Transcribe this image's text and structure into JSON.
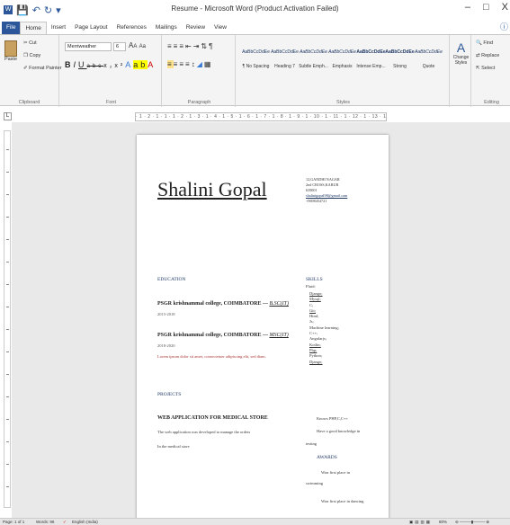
{
  "titlebar": {
    "title": "Resume - Microsoft Word (Product Activation Failed)",
    "minimize": "‒",
    "maximize": "□",
    "close": "X"
  },
  "tabs": [
    "File",
    "Home",
    "Insert",
    "Page Layout",
    "References",
    "Mailings",
    "Review",
    "View"
  ],
  "ribbon": {
    "clipboard": {
      "paste": "Paste",
      "cut": "Cut",
      "copy": "Copy",
      "format_painter": "Format Painter",
      "label": "Clipboard"
    },
    "font": {
      "name": "Merriweather",
      "size": "6",
      "label": "Font"
    },
    "paragraph": {
      "label": "Paragraph"
    },
    "styles": {
      "label": "Styles",
      "items": [
        {
          "preview": "AaBbCcDdEe",
          "name": "¶ No Spacing"
        },
        {
          "preview": "AaBbCcDdEe",
          "name": "Heading 7"
        },
        {
          "preview": "AaBbCcDdEe",
          "name": "Subtle Emph..."
        },
        {
          "preview": "AaBbCcDdEe",
          "name": "Emphasis"
        },
        {
          "preview": "AaBbCcDdEe",
          "name": "Intense Emp..."
        },
        {
          "preview": "AaBbCcDdEe",
          "name": "Strong"
        },
        {
          "preview": "AaBbCcDdEe",
          "name": "Quote"
        }
      ],
      "change_styles": "Change Styles"
    },
    "editing": {
      "find": "Find",
      "replace": "Replace",
      "select": "Select",
      "label": "Editing"
    }
  },
  "ruler": "· 1 · 2 · 1 · 1 · 1 · 2 · 1 · 3 · 1 · 4 · 1 · 5 · 1 · 6 · 1 · 7 · 1 · 8 · 1 · 9 · 1 · 10 · 1 · 11 · 1 · 12 · 1 · 13 · 1 · 14 · 1 · 15 · 1 · 16 · 1 · 17 · 1 · 18 · 1 · 19",
  "document": {
    "name": "Shalini Gopal",
    "contact": [
      "12,GANDHI NAGAR",
      "2nd CROSS,KARUR",
      "639001",
      "shalinigopal98@gmail.com",
      "+9698454721"
    ],
    "education": {
      "heading": "EDUCATION",
      "entries": [
        {
          "school": "PSGR krishnammal college, COIMBATORE —",
          "degree": "B.SC(IT)",
          "years": "2015-2018"
        },
        {
          "school": "PSGR krishnammal college, COIMBATORE —",
          "degree": "MSC(IT)",
          "years": "2018-2020"
        }
      ],
      "lorem": "Lorem ipsum dolor sit amet, consectetuer adipiscing elit, sed diam."
    },
    "projects": {
      "heading": "PROJECTS",
      "title": "WEB APPLICATION FOR MEDICAL STORE",
      "lines": [
        "The web application was developed to manage the orders",
        "In the medical store"
      ]
    },
    "skills": {
      "heading": "SKILLS",
      "intro": "Fluid:",
      "items": [
        "Django;",
        "Mysql;",
        "C;",
        "Git;",
        "Html;",
        "Js;",
        "Machine learning;",
        "C++;",
        "Angularjs;",
        "Kotlin;",
        "Php;",
        "Python;",
        "Django;"
      ],
      "extra": [
        "Knows PHP,C,C++",
        "Have a good knowledge in",
        "testing"
      ]
    },
    "awards": {
      "heading": "AWARDS",
      "lines": [
        "Won first place in",
        "swimming",
        "Won first place in dancing"
      ]
    }
  },
  "status": {
    "page": "Page: 1 of 1",
    "words": "Words: 96",
    "language": "English (India)",
    "zoom": "80%"
  }
}
